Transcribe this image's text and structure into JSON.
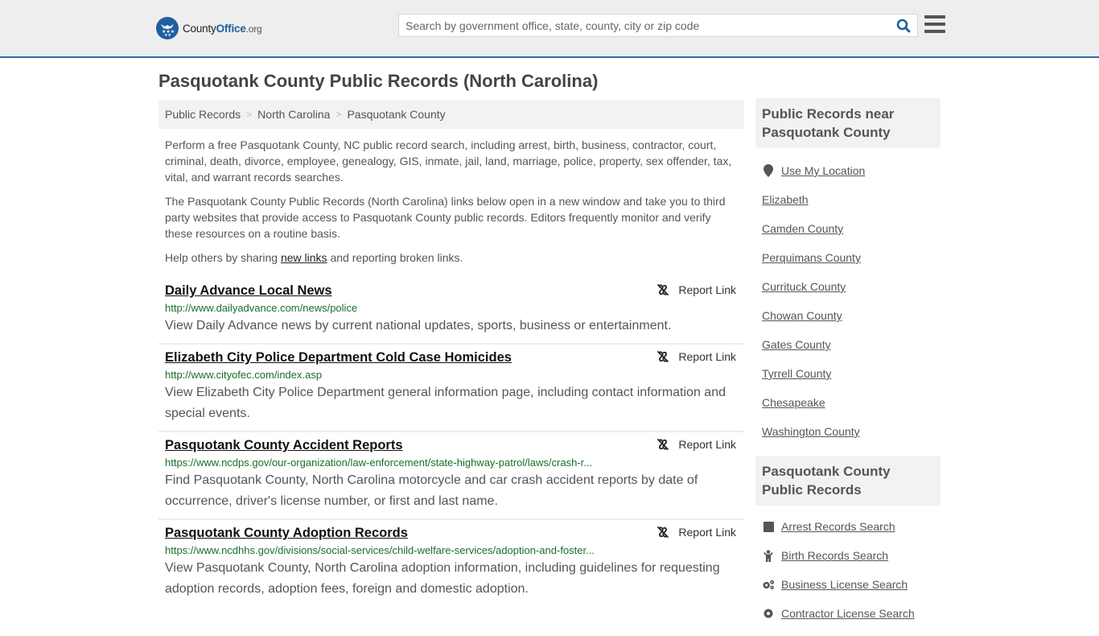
{
  "header": {
    "logo": {
      "name": "County",
      "brand": "Office",
      "tld": ".org"
    },
    "search_placeholder": "Search by government office, state, county, city or zip code",
    "search_value": "",
    "colors": {
      "brand_blue": "#1f5f9e",
      "header_bg": "#eeeeee",
      "header_border": "#2e6da4"
    }
  },
  "page": {
    "title": "Pasquotank County Public Records (North Carolina)",
    "breadcrumb": [
      "Public Records",
      "North Carolina",
      "Pasquotank County"
    ],
    "intro": {
      "p1": "Perform a free Pasquotank County, NC public record search, including arrest, birth, business, contractor, court, criminal, death, divorce, employee, genealogy, GIS, inmate, jail, land, marriage, police, property, sex offender, tax, vital, and warrant records searches.",
      "p2": "The Pasquotank County Public Records (North Carolina) links below open in a new window and take you to third party websites that provide access to Pasquotank County public records. Editors frequently monitor and verify these resources on a routine basis.",
      "p3_before": "Help others by sharing ",
      "p3_link": "new links",
      "p3_after": " and reporting broken links."
    }
  },
  "results": [
    {
      "title": "Daily Advance Local News",
      "url": "http://www.dailyadvance.com/news/police",
      "description": "View Daily Advance news by current national updates, sports, business or entertainment.",
      "report_label": "Report Link"
    },
    {
      "title": "Elizabeth City Police Department Cold Case Homicides",
      "url": "http://www.cityofec.com/index.asp",
      "description": "View Elizabeth City Police Department general information page, including contact information and special events.",
      "report_label": "Report Link"
    },
    {
      "title": "Pasquotank County Accident Reports",
      "url": "https://www.ncdps.gov/our-organization/law-enforcement/state-highway-patrol/laws/crash-r...",
      "description": "Find Pasquotank County, North Carolina motorcycle and car crash accident reports by date of occurrence, driver's license number, or first and last name.",
      "report_label": "Report Link"
    },
    {
      "title": "Pasquotank County Adoption Records",
      "url": "https://www.ncdhhs.gov/divisions/social-services/child-welfare-services/adoption-and-foster...",
      "description": "View Pasquotank County, North Carolina adoption information, including guidelines for requesting adoption records, adoption fees, foreign and domestic adoption.",
      "report_label": "Report Link"
    }
  ],
  "sidebar": {
    "nearby": {
      "heading": "Public Records near Pasquotank County",
      "use_location": {
        "label": "Use My Location",
        "icon": "map-pin-icon"
      },
      "items": [
        "Elizabeth",
        "Camden County",
        "Perquimans County",
        "Currituck County",
        "Chowan County",
        "Gates County",
        "Tyrrell County",
        "Chesapeake",
        "Washington County"
      ]
    },
    "records": {
      "heading": "Pasquotank County Public Records",
      "items": [
        {
          "label": "Arrest Records Search",
          "icon": "square-icon"
        },
        {
          "label": "Birth Records Search",
          "icon": "child-icon"
        },
        {
          "label": "Business License Search",
          "icon": "gears-icon"
        },
        {
          "label": "Contractor License Search",
          "icon": "gear-icon"
        }
      ]
    }
  }
}
